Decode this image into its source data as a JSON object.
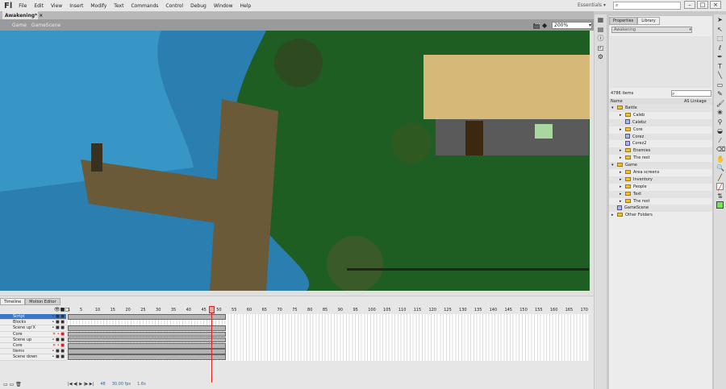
{
  "app": {
    "logo": "Fl",
    "menus": [
      "File",
      "Edit",
      "View",
      "Insert",
      "Modify",
      "Text",
      "Commands",
      "Control",
      "Debug",
      "Window",
      "Help"
    ],
    "workspace": "Essentials",
    "window_buttons": [
      "–",
      "□",
      "×"
    ]
  },
  "document": {
    "tab": "Awakening*",
    "breadcrumb": [
      "Game",
      "GameScene"
    ],
    "zoom": "200%"
  },
  "timeline": {
    "tabs": [
      "Timeline",
      "Motion Editor"
    ],
    "layers": [
      {
        "name": "Script",
        "selected": true
      },
      {
        "name": "Blocks",
        "folder": true
      },
      {
        "name": "Scene up'X"
      },
      {
        "name": "Core",
        "hidden": true
      },
      {
        "name": "Scene up"
      },
      {
        "name": "Core",
        "hidden": true
      },
      {
        "name": "Items"
      },
      {
        "name": "Scene down"
      }
    ],
    "frame_labels": [
      "1",
      "5",
      "10",
      "15",
      "20",
      "25",
      "30",
      "35",
      "40",
      "45",
      "50",
      "55",
      "60",
      "65",
      "70",
      "75",
      "80",
      "85",
      "90",
      "95",
      "100",
      "105",
      "110",
      "115",
      "120",
      "125",
      "130",
      "135",
      "140",
      "145",
      "150",
      "155",
      "160",
      "165",
      "170"
    ],
    "current_frame": "48",
    "fps": "30.00 fps",
    "time": "1.6s"
  },
  "panel": {
    "tabs": [
      "Properties",
      "Library"
    ],
    "library": "Awakening",
    "count": "4786 items",
    "columns": [
      "Name",
      "AS Linkage"
    ],
    "items": [
      {
        "label": "Battle",
        "type": "folder",
        "level": 0,
        "open": true
      },
      {
        "label": "Caleb",
        "type": "folder",
        "level": 1
      },
      {
        "label": "Calebz",
        "type": "symbol",
        "level": 1
      },
      {
        "label": "Core",
        "type": "folder",
        "level": 1
      },
      {
        "label": "Corez",
        "type": "symbol",
        "level": 1
      },
      {
        "label": "Corez2",
        "type": "symbol",
        "level": 1
      },
      {
        "label": "Enemies",
        "type": "folder",
        "level": 1
      },
      {
        "label": "The rest",
        "type": "folder",
        "level": 1
      },
      {
        "label": "Game",
        "type": "folder",
        "level": 0,
        "open": true
      },
      {
        "label": "Area screens",
        "type": "folder",
        "level": 1
      },
      {
        "label": "Inventory",
        "type": "folder",
        "level": 1
      },
      {
        "label": "People",
        "type": "folder",
        "level": 1
      },
      {
        "label": "Text",
        "type": "folder",
        "level": 1
      },
      {
        "label": "The rest",
        "type": "folder",
        "level": 1
      },
      {
        "label": "GameScene",
        "type": "symbol",
        "level": 0
      },
      {
        "label": "Other Folders",
        "type": "folder",
        "level": 0
      }
    ]
  },
  "colors": {
    "fill": "#66ee44",
    "playhead": "#dd2222",
    "selection": "#3b77c8"
  }
}
